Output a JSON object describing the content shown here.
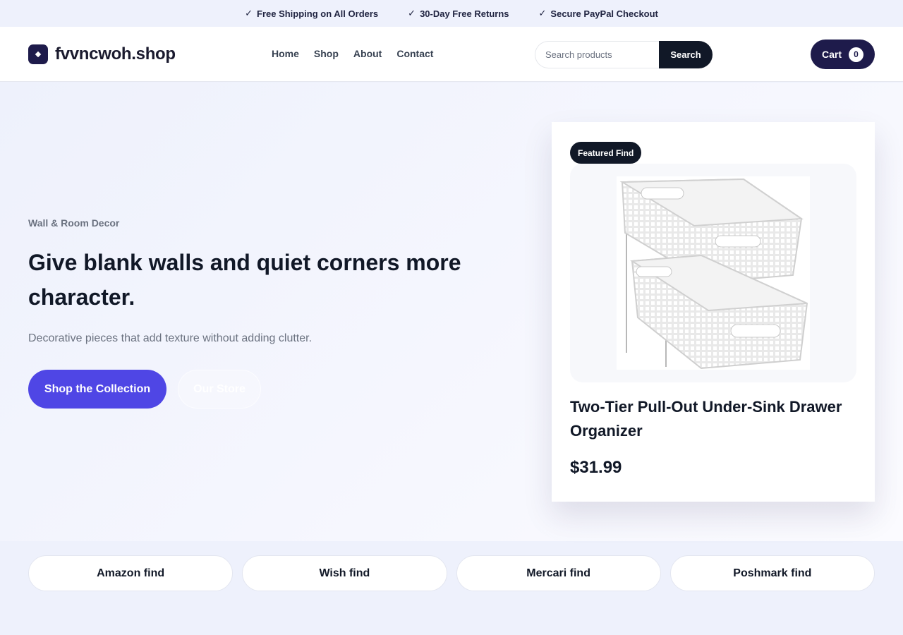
{
  "topbar": {
    "perks": [
      {
        "icon": "check-icon",
        "label": "Free Shipping on All Orders"
      },
      {
        "icon": "check-icon",
        "label": "30-Day Free Returns"
      },
      {
        "icon": "check-icon",
        "label": "Secure PayPal Checkout"
      }
    ]
  },
  "header": {
    "logo_text": "fvvncwoh.shop",
    "nav": [
      "Home",
      "Shop",
      "About",
      "Contact"
    ],
    "search": {
      "placeholder": "Search products",
      "button_label": "Search"
    },
    "cart": {
      "label": "Cart",
      "count": "0"
    }
  },
  "hero": {
    "eyebrow": "Wall & Room Decor",
    "headline": "Give blank walls and quiet corners more character.",
    "subline": "Decorative pieces that add texture without adding clutter.",
    "primary_cta": "Shop the Collection",
    "secondary_cta": "Our Store"
  },
  "featured": {
    "badge": "Featured Find",
    "title": "Two-Tier Pull-Out Under-Sink Drawer Organizer",
    "price": "$31.99"
  },
  "marketplaces": [
    "Amazon find",
    "Wish find",
    "Mercari find",
    "Poshmark find"
  ],
  "colors": {
    "brand_dark": "#1e1b4b",
    "accent": "#4f46e5",
    "text": "#111827",
    "muted": "#6b7280"
  }
}
